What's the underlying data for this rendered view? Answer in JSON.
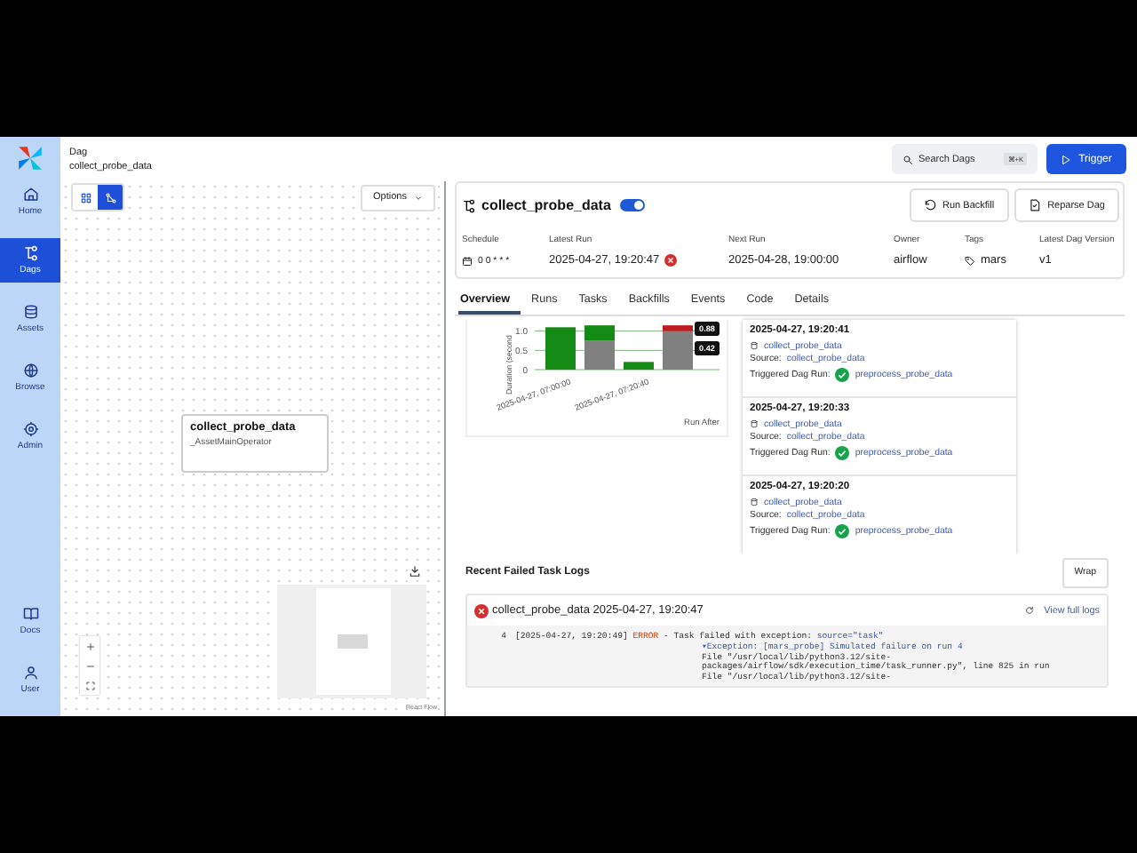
{
  "sidebar": {
    "items": [
      {
        "label": "Home",
        "selected": false
      },
      {
        "label": "Dags",
        "selected": true
      },
      {
        "label": "Assets",
        "selected": false
      },
      {
        "label": "Browse",
        "selected": false
      },
      {
        "label": "Admin",
        "selected": false
      },
      {
        "label": "Docs",
        "selected": false
      },
      {
        "label": "User",
        "selected": false
      }
    ]
  },
  "breadcrumb": {
    "label": "Dag",
    "value": "collect_probe_data"
  },
  "search": {
    "label": "Search Dags",
    "shortcut": "⌘+K"
  },
  "trigger_button": "Trigger",
  "graph": {
    "view_toggles": [
      {
        "selected": false
      },
      {
        "selected": true
      }
    ],
    "options_button": "Options",
    "node": {
      "title": "collect_probe_data",
      "operator": "_AssetMainOperator"
    },
    "attribution": "React Flow"
  },
  "dag": {
    "title": "collect_probe_data",
    "enabled": true,
    "buttons": [
      "Run Backfill",
      "Reparse Dag"
    ],
    "details": [
      {
        "label": "Schedule",
        "value": "0 0 * * *",
        "kind": "schedule"
      },
      {
        "label": "Latest Run",
        "value": "2025-04-27, 19:20:47",
        "kind": "run",
        "failed": true
      },
      {
        "label": "Next Run",
        "value": "2025-04-28, 19:00:00",
        "kind": "plain"
      },
      {
        "label": "Owner",
        "value": "airflow",
        "kind": "plain"
      },
      {
        "label": "Tags",
        "value": "mars",
        "kind": "tag"
      },
      {
        "label": "Latest Dag Version",
        "value": "v1",
        "kind": "plain"
      }
    ]
  },
  "tabs": [
    {
      "label": "Overview",
      "selected": true
    },
    {
      "label": "Runs",
      "selected": false
    },
    {
      "label": "Tasks",
      "selected": false
    },
    {
      "label": "Backfills",
      "selected": false
    },
    {
      "label": "Events",
      "selected": false
    },
    {
      "label": "Code",
      "selected": false
    },
    {
      "label": "Details",
      "selected": false
    }
  ],
  "overview": {
    "chart_data": {
      "type": "bar",
      "stacked": true,
      "ylabel": "Duration (second",
      "ylim": [
        0,
        1.2
      ],
      "yticks": [
        0,
        0.5,
        {
          "value": 1,
          "label": "1.0"
        }
      ],
      "categories": [
        "2025-04-27, 07:00:00",
        null,
        "2025-04-27, 07:20:40",
        null
      ],
      "series": [
        {
          "color": "#808080",
          "values": [
            0,
            0.75,
            0,
            1.0
          ]
        },
        {
          "color": "#138a13",
          "values": [
            1.1,
            0.4,
            0.2,
            0
          ]
        },
        {
          "color": "#c0191f",
          "values": [
            0,
            0,
            0,
            0.15
          ]
        }
      ],
      "annotations": [
        "0.88",
        "0.42",
        "Run After"
      ]
    },
    "events": [
      {
        "time": "2025-04-27, 19:20:41",
        "asset": "collect_probe_data",
        "source_label": "Source:",
        "source": "collect_probe_data",
        "trigger_label": "Triggered Dag Run:",
        "run": "preprocess_probe_data",
        "run_succeeded": true
      },
      {
        "time": "2025-04-27, 19:20:33",
        "asset": "collect_probe_data",
        "source_label": "Source:",
        "source": "collect_probe_data",
        "trigger_label": "Triggered Dag Run:",
        "run": "preprocess_probe_data",
        "run_succeeded": true
      },
      {
        "time": "2025-04-27, 19:20:20",
        "asset": "collect_probe_data",
        "source_label": "Source:",
        "source": "collect_probe_data",
        "trigger_label": "Triggered Dag Run:",
        "run": "preprocess_probe_data",
        "run_succeeded": true
      }
    ]
  },
  "logs": {
    "title": "Recent Failed Task Logs",
    "wrap_button": "Wrap",
    "task": {
      "failed": true,
      "label": "collect_probe_data 2025-04-27, 19:20:47",
      "view_link": "View full logs"
    },
    "lines": [
      {
        "number": "4",
        "segments": [
          {
            "kind": "plain",
            "text": "[2025-04-27, 19:20:49] "
          },
          {
            "kind": "level",
            "text": "ERROR"
          },
          {
            "kind": "plain",
            "text": " - Task failed with exception: "
          },
          {
            "kind": "key",
            "text": "source=\"task\""
          }
        ]
      },
      {
        "segments": [
          {
            "kind": "key",
            "text": "▾Exception: [mars_probe] Simulated failure on run 4"
          }
        ]
      },
      {
        "segments": [
          {
            "kind": "plain",
            "text": "File \"/usr/local/lib/python3.12/site-"
          }
        ]
      },
      {
        "segments": [
          {
            "kind": "plain",
            "text": "packages/airflow/sdk/execution_time/task_runner.py\", line 825 in run"
          }
        ]
      },
      {
        "segments": [
          {
            "kind": "plain",
            "text": "File \"/usr/local/lib/python3.12/site-"
          }
        ]
      }
    ]
  }
}
